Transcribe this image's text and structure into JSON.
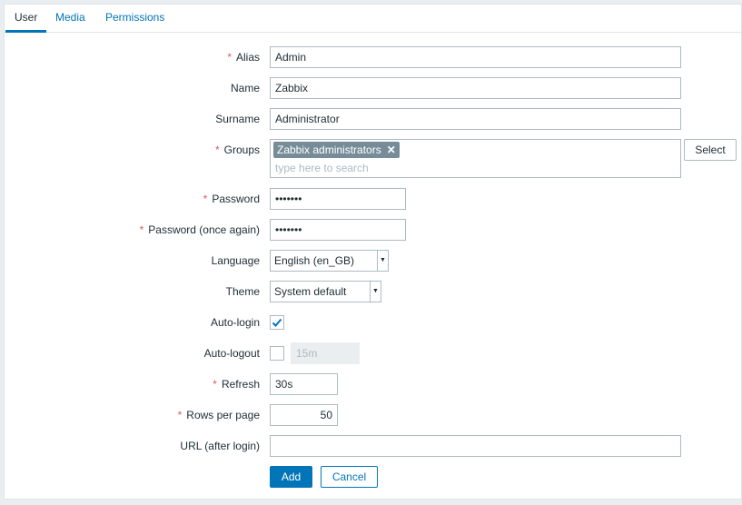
{
  "tabs": [
    {
      "label": "User",
      "active": true
    },
    {
      "label": "Media",
      "active": false
    },
    {
      "label": "Permissions",
      "active": false
    }
  ],
  "form": {
    "alias": {
      "label": "Alias",
      "required": true,
      "value": "Admin"
    },
    "name": {
      "label": "Name",
      "required": false,
      "value": "Zabbix"
    },
    "surname": {
      "label": "Surname",
      "required": false,
      "value": "Administrator"
    },
    "groups": {
      "label": "Groups",
      "required": true,
      "selected": [
        "Zabbix administrators"
      ],
      "placeholder": "type here to search",
      "select_button": "Select",
      "remove_icon": "close-icon"
    },
    "password": {
      "label": "Password",
      "required": true,
      "value": "•••••••"
    },
    "password_again": {
      "label": "Password (once again)",
      "required": true,
      "value": "•••••••"
    },
    "language": {
      "label": "Language",
      "value": "English (en_GB)"
    },
    "theme": {
      "label": "Theme",
      "value": "System default"
    },
    "autologin": {
      "label": "Auto-login",
      "checked": true
    },
    "autologout": {
      "label": "Auto-logout",
      "checked": false,
      "value": "15m"
    },
    "refresh": {
      "label": "Refresh",
      "required": true,
      "value": "30s"
    },
    "rows_per_page": {
      "label": "Rows per page",
      "required": true,
      "value": "50"
    },
    "url": {
      "label": "URL (after login)",
      "value": ""
    }
  },
  "buttons": {
    "add": "Add",
    "cancel": "Cancel"
  },
  "required_marker": "*",
  "colors": {
    "accent": "#0275b8",
    "required": "#e45959",
    "chip": "#768d99",
    "border": "#acbbc2"
  }
}
